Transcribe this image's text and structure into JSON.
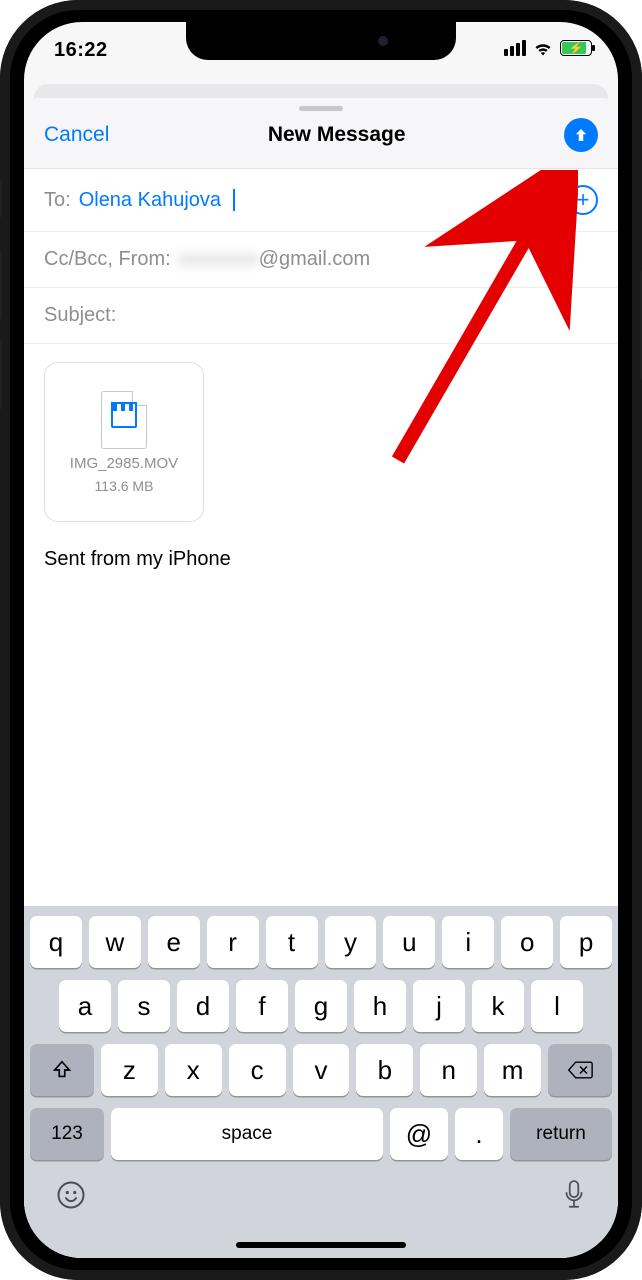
{
  "status": {
    "time": "16:22"
  },
  "header": {
    "cancel": "Cancel",
    "title": "New Message"
  },
  "fields": {
    "to_label": "To:",
    "recipient": "Olena Kahujova",
    "ccbcc_label": "Cc/Bcc, From:",
    "from_domain": "@gmail.com",
    "subject_label": "Subject:"
  },
  "attachment": {
    "filename": "IMG_2985.MOV",
    "filesize": "113.6 MB"
  },
  "signature": "Sent from my iPhone",
  "keyboard": {
    "row1": [
      "q",
      "w",
      "e",
      "r",
      "t",
      "y",
      "u",
      "i",
      "o",
      "p"
    ],
    "row2": [
      "a",
      "s",
      "d",
      "f",
      "g",
      "h",
      "j",
      "k",
      "l"
    ],
    "row3": [
      "z",
      "x",
      "c",
      "v",
      "b",
      "n",
      "m"
    ],
    "numbers": "123",
    "space": "space",
    "at": "@",
    "dot": ".",
    "return": "return"
  }
}
